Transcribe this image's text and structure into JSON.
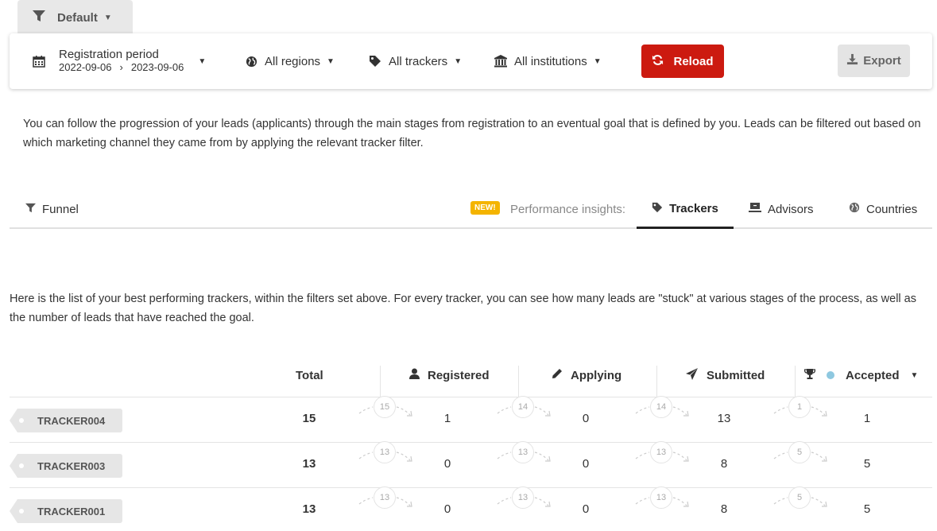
{
  "preset": {
    "label": "Default"
  },
  "filters": {
    "period": {
      "title": "Registration period",
      "start": "2022-09-06",
      "separator": "›",
      "end": "2023-09-06"
    },
    "regions": "All regions",
    "trackers": "All trackers",
    "institutions": "All institutions",
    "reload_label": "Reload",
    "export_label": "Export"
  },
  "intro_text": "You can follow the progression of your leads (applicants) through the main stages from registration to an eventual goal that is defined by you. Leads can be filtered out based on which marketing channel they came from by applying the relevant tracker filter.",
  "tabs": {
    "funnel": "Funnel",
    "new_badge": "NEW!",
    "insights_label": "Performance insights:",
    "trackers": "Trackers",
    "advisors": "Advisors",
    "countries": "Countries",
    "active": "trackers"
  },
  "list_intro": "Here is the list of your best performing trackers, within the filters set above. For every tracker, you can see how many leads are \"stuck\" at various stages of the process, as well as the number of leads that have reached the goal.",
  "table": {
    "headers": {
      "total": "Total",
      "registered": "Registered",
      "applying": "Applying",
      "submitted": "Submitted",
      "accepted": "Accepted"
    },
    "accent_dot_color": "#8ec8e0",
    "rows": [
      {
        "tracker": "TRACKER004",
        "total": "15",
        "flow1": "15",
        "registered": "1",
        "flow2": "14",
        "applying": "0",
        "flow3": "14",
        "submitted": "13",
        "flow4": "1",
        "accepted": "1"
      },
      {
        "tracker": "TRACKER003",
        "total": "13",
        "flow1": "13",
        "registered": "0",
        "flow2": "13",
        "applying": "0",
        "flow3": "13",
        "submitted": "8",
        "flow4": "5",
        "accepted": "5"
      },
      {
        "tracker": "TRACKER001",
        "total": "13",
        "flow1": "13",
        "registered": "0",
        "flow2": "13",
        "applying": "0",
        "flow3": "13",
        "submitted": "8",
        "flow4": "5",
        "accepted": "5"
      }
    ]
  },
  "colors": {
    "reload": "#cc1a10",
    "new_badge": "#f4b400"
  }
}
